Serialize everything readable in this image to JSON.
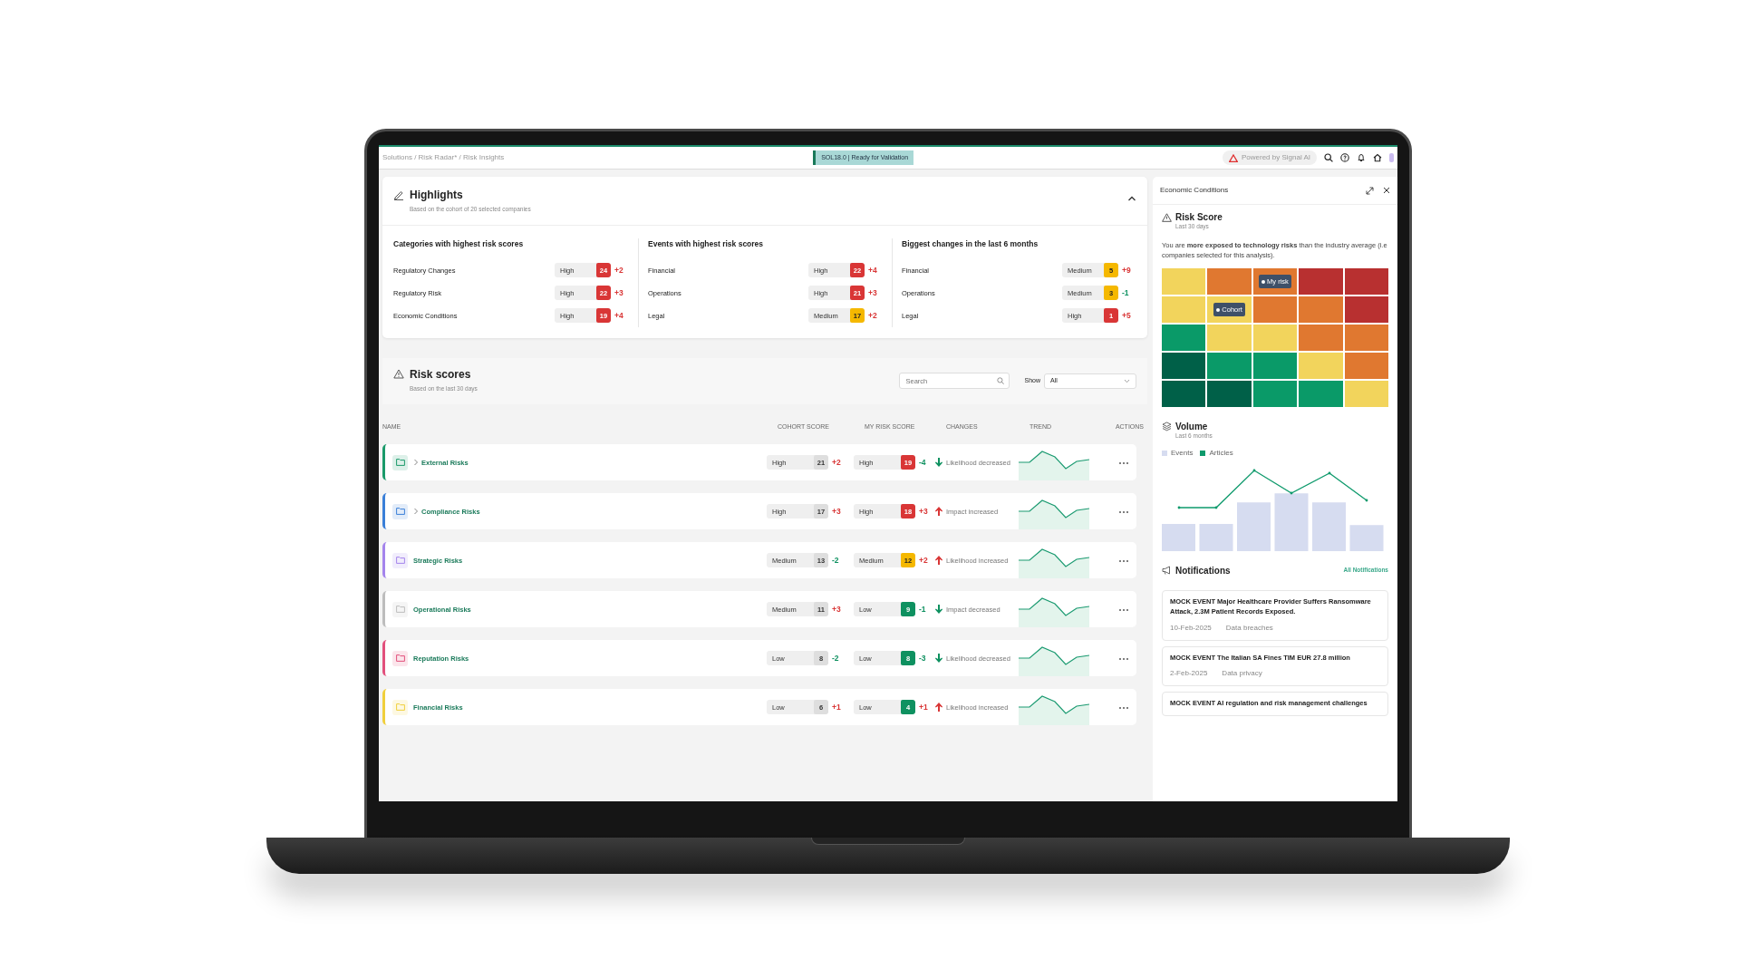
{
  "top_bar": {
    "breadcrumb": "Solutions / Risk Radar* / Risk Insights",
    "env_badge": "SOL18.0 | Ready for Validation",
    "powered_by": "Powered by Signal AI"
  },
  "highlights": {
    "title": "Highlights",
    "subtitle": "Based on the cohort of 20 selected companies",
    "expanded": true,
    "groups": [
      {
        "title": "Categories with highest risk scores",
        "items": [
          {
            "name": "Regulatory Changes",
            "rating": "High",
            "score": "24",
            "color": "#d93636",
            "change": {
              "text": "+2",
              "color": "#d93636"
            }
          },
          {
            "name": "Regulatory Risk",
            "rating": "High",
            "score": "22",
            "color": "#d93636",
            "change": {
              "text": "+3",
              "color": "#d93636"
            }
          },
          {
            "name": "Economic Conditions",
            "rating": "High",
            "score": "19",
            "color": "#d93636",
            "change": {
              "text": "+4",
              "color": "#d93636"
            }
          }
        ]
      },
      {
        "title": "Events with highest risk scores",
        "items": [
          {
            "name": "Financial",
            "rating": "High",
            "score": "22",
            "color": "#d93636",
            "change": {
              "text": "+4",
              "color": "#d93636"
            }
          },
          {
            "name": "Operations",
            "rating": "High",
            "score": "21",
            "color": "#d93636",
            "change": {
              "text": "+3",
              "color": "#d93636"
            }
          },
          {
            "name": "Legal",
            "rating": "Medium",
            "score": "17",
            "color": "#f5b800",
            "change": {
              "text": "+2",
              "color": "#d93636"
            }
          }
        ]
      },
      {
        "title": "Biggest changes in the last 6 months",
        "items": [
          {
            "name": "Financial",
            "rating": "Medium",
            "score": "5",
            "color": "#f5b800",
            "change": {
              "text": "+9",
              "color": "#d93636"
            }
          },
          {
            "name": "Operations",
            "rating": "Medium",
            "score": "3",
            "color": "#f5b800",
            "change": {
              "text": "-1",
              "color": "#0e9160"
            }
          },
          {
            "name": "Legal",
            "rating": "High",
            "score": "1",
            "color": "#d93636",
            "change": {
              "text": "+5",
              "color": "#d93636"
            }
          }
        ]
      }
    ]
  },
  "risk_scores": {
    "title": "Risk scores",
    "subtitle": "Based on the last 30 days",
    "search": {
      "placeholder": "Search"
    },
    "show": {
      "label": "Show",
      "value": "All"
    },
    "columns": [
      "NAME",
      "COHORT SCORE",
      "MY RISK SCORE",
      "CHANGES",
      "TREND",
      "ACTIONS"
    ],
    "rows": [
      {
        "name": "External Risks",
        "color": "#1a9a6a",
        "expandable": true,
        "cohort": {
          "rating": "High",
          "score": "21",
          "change": {
            "text": "+2",
            "color": "#d93636"
          }
        },
        "mine": {
          "rating": "High",
          "score": "19",
          "color": "#d93636",
          "change": {
            "text": "-4",
            "color": "#0e9160"
          }
        },
        "changes": {
          "kind": "down",
          "text": "Likelihood decreased",
          "color": "#0e9160"
        }
      },
      {
        "name": "Compliance Risks",
        "color": "#3a7fd8",
        "expandable": true,
        "cohort": {
          "rating": "High",
          "score": "17",
          "change": {
            "text": "+3",
            "color": "#d93636"
          }
        },
        "mine": {
          "rating": "High",
          "score": "18",
          "color": "#d93636",
          "change": {
            "text": "+3",
            "color": "#d93636"
          }
        },
        "changes": {
          "kind": "up",
          "text": "Impact increased",
          "color": "#d93636"
        }
      },
      {
        "name": "Strategic Risks",
        "color": "#a484ec",
        "expandable": false,
        "cohort": {
          "rating": "Medium",
          "score": "13",
          "change": {
            "text": "-2",
            "color": "#0e9160"
          }
        },
        "mine": {
          "rating": "Medium",
          "score": "12",
          "color": "#f5b800",
          "change": {
            "text": "+2",
            "color": "#d93636"
          }
        },
        "changes": {
          "kind": "up",
          "text": "Likelihood increased",
          "color": "#d93636"
        }
      },
      {
        "name": "Operational Risks",
        "color": "#bdbdbd",
        "expandable": false,
        "cohort": {
          "rating": "Medium",
          "score": "11",
          "change": {
            "text": "+3",
            "color": "#d93636"
          }
        },
        "mine": {
          "rating": "Low",
          "score": "9",
          "color": "#0e9160",
          "change": {
            "text": "-1",
            "color": "#0e9160"
          }
        },
        "changes": {
          "kind": "down",
          "text": "Impact decreased",
          "color": "#0e9160"
        }
      },
      {
        "name": "Reputation Risks",
        "color": "#e2507c",
        "expandable": false,
        "cohort": {
          "rating": "Low",
          "score": "8",
          "change": {
            "text": "-2",
            "color": "#0e9160"
          }
        },
        "mine": {
          "rating": "Low",
          "score": "8",
          "color": "#0e9160",
          "change": {
            "text": "-3",
            "color": "#0e9160"
          }
        },
        "changes": {
          "kind": "down",
          "text": "Likelihood decreased",
          "color": "#0e9160"
        }
      },
      {
        "name": "Financial Risks",
        "color": "#f0cf3c",
        "expandable": false,
        "cohort": {
          "rating": "Low",
          "score": "6",
          "change": {
            "text": "+1",
            "color": "#d93636"
          }
        },
        "mine": {
          "rating": "Low",
          "score": "4",
          "color": "#0e9160",
          "change": {
            "text": "+1",
            "color": "#d93636"
          }
        },
        "changes": {
          "kind": "up",
          "text": "Likelihood increased",
          "color": "#d93636"
        }
      }
    ]
  },
  "side_panel": {
    "title": "Economic Conditions",
    "risk_score": {
      "title": "Risk Score",
      "subtitle": "Last 30 days",
      "text": "You are **more exposed to technology risks** than the industry average (i.e companies selected for this analysis).",
      "heatmap": [
        [
          {
            "color": "#f2d45c"
          },
          {
            "color": "#e07830"
          },
          {
            "color": "#e07830",
            "marker": "My risk"
          },
          {
            "color": "#b83030"
          },
          {
            "color": "#b83030"
          }
        ],
        [
          {
            "color": "#f2d45c"
          },
          {
            "color": "#f2d45c",
            "marker": "Cohort"
          },
          {
            "color": "#e07830"
          },
          {
            "color": "#e07830"
          },
          {
            "color": "#b83030"
          }
        ],
        [
          {
            "color": "#0a9a68"
          },
          {
            "color": "#f2d45c"
          },
          {
            "color": "#f2d45c"
          },
          {
            "color": "#e07830"
          },
          {
            "color": "#e07830"
          }
        ],
        [
          {
            "color": "#006048"
          },
          {
            "color": "#0a9a68"
          },
          {
            "color": "#0a9a68"
          },
          {
            "color": "#f2d45c"
          },
          {
            "color": "#e07830"
          }
        ],
        [
          {
            "color": "#006048"
          },
          {
            "color": "#006048"
          },
          {
            "color": "#0a9a68"
          },
          {
            "color": "#0a9a68"
          },
          {
            "color": "#f2d45c"
          }
        ]
      ]
    },
    "volume": {
      "title": "Volume",
      "subtitle": "Last 6 months",
      "legend": [
        {
          "label": "Events",
          "color": "#d6dcf0"
        },
        {
          "label": "Articles",
          "color": "#0e9a6c"
        }
      ]
    },
    "notifications": {
      "title": "Notifications",
      "link": "All Notifications",
      "items": [
        {
          "title": "MOCK EVENT Major Healthcare Provider Suffers Ransomware Attack, 2.3M Patient Records Exposed.",
          "date": "10-Feb-2025",
          "category": "Data breaches"
        },
        {
          "title": "MOCK EVENT The Italian SA Fines TIM EUR 27.8 million",
          "date": "2-Feb-2025",
          "category": "Data privacy"
        },
        {
          "title": "MOCK EVENT AI regulation and risk management challenges"
        }
      ]
    }
  }
}
